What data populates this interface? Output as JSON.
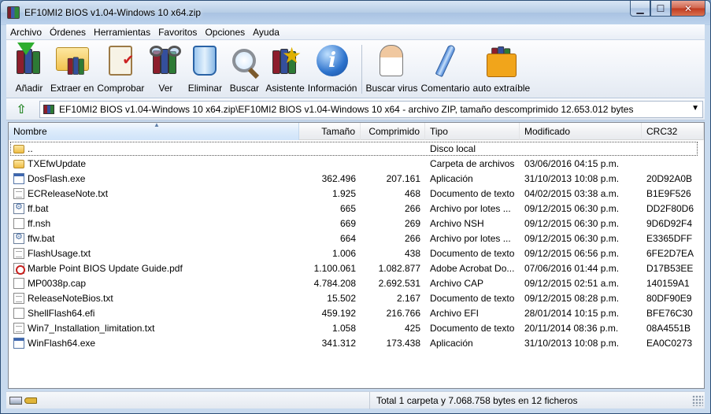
{
  "window": {
    "title": "EF10MI2 BIOS v1.04-Windows 10 x64.zip",
    "controls": {
      "minimize": "▁",
      "maximize": "☐",
      "close": "✕"
    }
  },
  "menu": [
    "Archivo",
    "Órdenes",
    "Herramientas",
    "Favoritos",
    "Opciones",
    "Ayuda"
  ],
  "toolbar": [
    {
      "label": "Añadir",
      "icon": "add-archive-icon"
    },
    {
      "label": "Extraer en",
      "icon": "extract-folder-icon"
    },
    {
      "label": "Comprobar",
      "icon": "test-clipboard-icon"
    },
    {
      "label": "Ver",
      "icon": "view-glasses-icon"
    },
    {
      "label": "Eliminar",
      "icon": "delete-bin-icon"
    },
    {
      "label": "Buscar",
      "icon": "search-magnifier-icon"
    },
    {
      "label": "Asistente",
      "icon": "wizard-icon"
    },
    {
      "label": "Información",
      "icon": "info-icon"
    },
    {
      "label": "Buscar virus",
      "icon": "virus-scan-icon"
    },
    {
      "label": "Comentario",
      "icon": "comment-pen-icon"
    },
    {
      "label": "auto extraíble",
      "icon": "sfx-gift-icon"
    }
  ],
  "address": {
    "path": "EF10MI2 BIOS v1.04-Windows 10 x64.zip\\EF10MI2 BIOS v1.04-Windows 10 x64 - archivo ZIP, tamaño descomprimido 12.653.012 bytes"
  },
  "columns": {
    "name": "Nombre",
    "size": "Tamaño",
    "compressed": "Comprimido",
    "type": "Tipo",
    "modified": "Modificado",
    "crc": "CRC32"
  },
  "files": [
    {
      "name": "..",
      "size": "",
      "compressed": "",
      "type": "Disco local",
      "modified": "",
      "crc": "",
      "icon": "folder"
    },
    {
      "name": "TXEfwUpdate",
      "size": "",
      "compressed": "",
      "type": "Carpeta de archivos",
      "modified": "03/06/2016 04:15 p.m.",
      "crc": "",
      "icon": "folder"
    },
    {
      "name": "DosFlash.exe",
      "size": "362.496",
      "compressed": "207.161",
      "type": "Aplicación",
      "modified": "31/10/2013 10:08 p.m.",
      "crc": "20D92A0B",
      "icon": "exe"
    },
    {
      "name": "ECReleaseNote.txt",
      "size": "1.925",
      "compressed": "468",
      "type": "Documento de texto",
      "modified": "04/02/2015 03:38 a.m.",
      "crc": "B1E9F526",
      "icon": "txt"
    },
    {
      "name": "ff.bat",
      "size": "665",
      "compressed": "266",
      "type": "Archivo por lotes ...",
      "modified": "09/12/2015 06:30 p.m.",
      "crc": "DD2F80D6",
      "icon": "bat"
    },
    {
      "name": "ff.nsh",
      "size": "669",
      "compressed": "269",
      "type": "Archivo NSH",
      "modified": "09/12/2015 06:30 p.m.",
      "crc": "9D6D92F4",
      "icon": "blank"
    },
    {
      "name": "ffw.bat",
      "size": "664",
      "compressed": "266",
      "type": "Archivo por lotes ...",
      "modified": "09/12/2015 06:30 p.m.",
      "crc": "E3365DFF",
      "icon": "bat"
    },
    {
      "name": "FlashUsage.txt",
      "size": "1.006",
      "compressed": "438",
      "type": "Documento de texto",
      "modified": "09/12/2015 06:56 p.m.",
      "crc": "6FE2D7EA",
      "icon": "txt"
    },
    {
      "name": "Marble Point BIOS Update Guide.pdf",
      "size": "1.100.061",
      "compressed": "1.082.877",
      "type": "Adobe Acrobat Do...",
      "modified": "07/06/2016 01:44 p.m.",
      "crc": "D17B53EE",
      "icon": "pdf"
    },
    {
      "name": "MP0038p.cap",
      "size": "4.784.208",
      "compressed": "2.692.531",
      "type": "Archivo CAP",
      "modified": "09/12/2015 02:51 a.m.",
      "crc": "140159A1",
      "icon": "blank"
    },
    {
      "name": "ReleaseNoteBios.txt",
      "size": "15.502",
      "compressed": "2.167",
      "type": "Documento de texto",
      "modified": "09/12/2015 08:28 p.m.",
      "crc": "80DF90E9",
      "icon": "txt"
    },
    {
      "name": "ShellFlash64.efi",
      "size": "459.192",
      "compressed": "216.766",
      "type": "Archivo EFI",
      "modified": "28/01/2014 10:15 p.m.",
      "crc": "BFE76C30",
      "icon": "blank"
    },
    {
      "name": "Win7_Installation_limitation.txt",
      "size": "1.058",
      "compressed": "425",
      "type": "Documento de texto",
      "modified": "20/11/2014 08:36 p.m.",
      "crc": "08A4551B",
      "icon": "txt"
    },
    {
      "name": "WinFlash64.exe",
      "size": "341.312",
      "compressed": "173.438",
      "type": "Aplicación",
      "modified": "31/10/2013 10:08 p.m.",
      "crc": "EA0C0273",
      "icon": "exe"
    }
  ],
  "status": {
    "text": "Total 1 carpeta y 7.068.758 bytes en 12 ficheros"
  }
}
